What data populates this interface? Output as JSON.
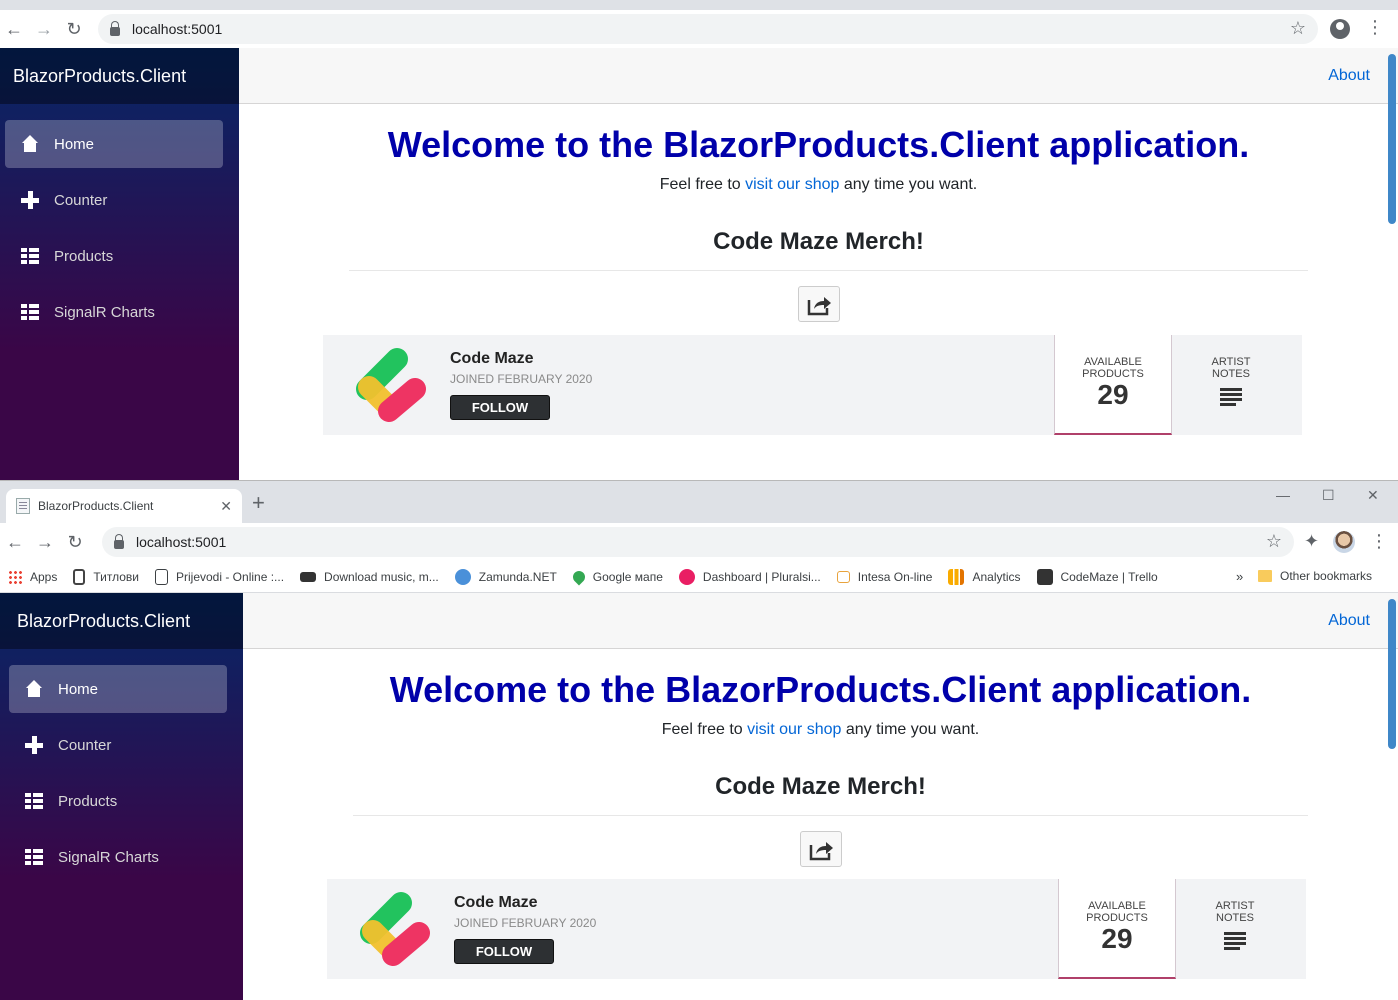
{
  "browser_back": {
    "url": "localhost:5001"
  },
  "browser_front": {
    "tab_title": "BlazorProducts.Client",
    "url": "localhost:5001",
    "bookmarks": [
      {
        "label": "Apps",
        "icon": "apps-grid-icon",
        "color": "#ea4335"
      },
      {
        "label": "Титлови",
        "icon": "document-icon",
        "color": "#444444"
      },
      {
        "label": "Prijevodi - Online :...",
        "icon": "page-icon",
        "color": "#3c4043"
      },
      {
        "label": "Download music, m...",
        "icon": "car-icon",
        "color": "#333333"
      },
      {
        "label": "Zamunda.NET",
        "icon": "globe-icon",
        "color": "#4a90d9"
      },
      {
        "label": "Google мапе",
        "icon": "maps-pin-icon",
        "color": "#34a853"
      },
      {
        "label": "Dashboard | Pluralsi...",
        "icon": "pluralsight-icon",
        "color": "#e91e63"
      },
      {
        "label": "Intesa On-line",
        "icon": "bank-icon",
        "color": "#e8a33d"
      },
      {
        "label": "Analytics",
        "icon": "analytics-icon",
        "color": "#f9ab00"
      },
      {
        "label": "CodeMaze | Trello",
        "icon": "trello-icon",
        "color": "#333333"
      }
    ],
    "bookmarks_overflow": "»",
    "other_bookmarks": "Other bookmarks"
  },
  "app": {
    "brand": "BlazorProducts.Client",
    "nav": [
      {
        "label": "Home",
        "icon": "home-icon",
        "active": true
      },
      {
        "label": "Counter",
        "icon": "plus-icon",
        "active": false
      },
      {
        "label": "Products",
        "icon": "list-icon",
        "active": false
      },
      {
        "label": "SignalR Charts",
        "icon": "list-icon",
        "active": false
      }
    ],
    "about": "About",
    "welcome": "Welcome to the BlazorProducts.Client application.",
    "sub_before": "Feel free to ",
    "sub_link": "visit our shop",
    "sub_after": " any time you want.",
    "merch_title": "Code Maze Merch!",
    "shop": {
      "name": "Code Maze",
      "joined": "JOINED FEBRUARY 2020",
      "follow": "FOLLOW",
      "stat_products_label_1": "AVAILABLE",
      "stat_products_label_2": "PRODUCTS",
      "stat_products_value": "29",
      "stat_notes_label_1": "ARTIST",
      "stat_notes_label_2": "NOTES"
    }
  },
  "colors": {
    "welcome": "#0000aa",
    "link": "#0366d6",
    "sidebar_top": "#052767",
    "sidebar_bottom": "#3a0647"
  }
}
